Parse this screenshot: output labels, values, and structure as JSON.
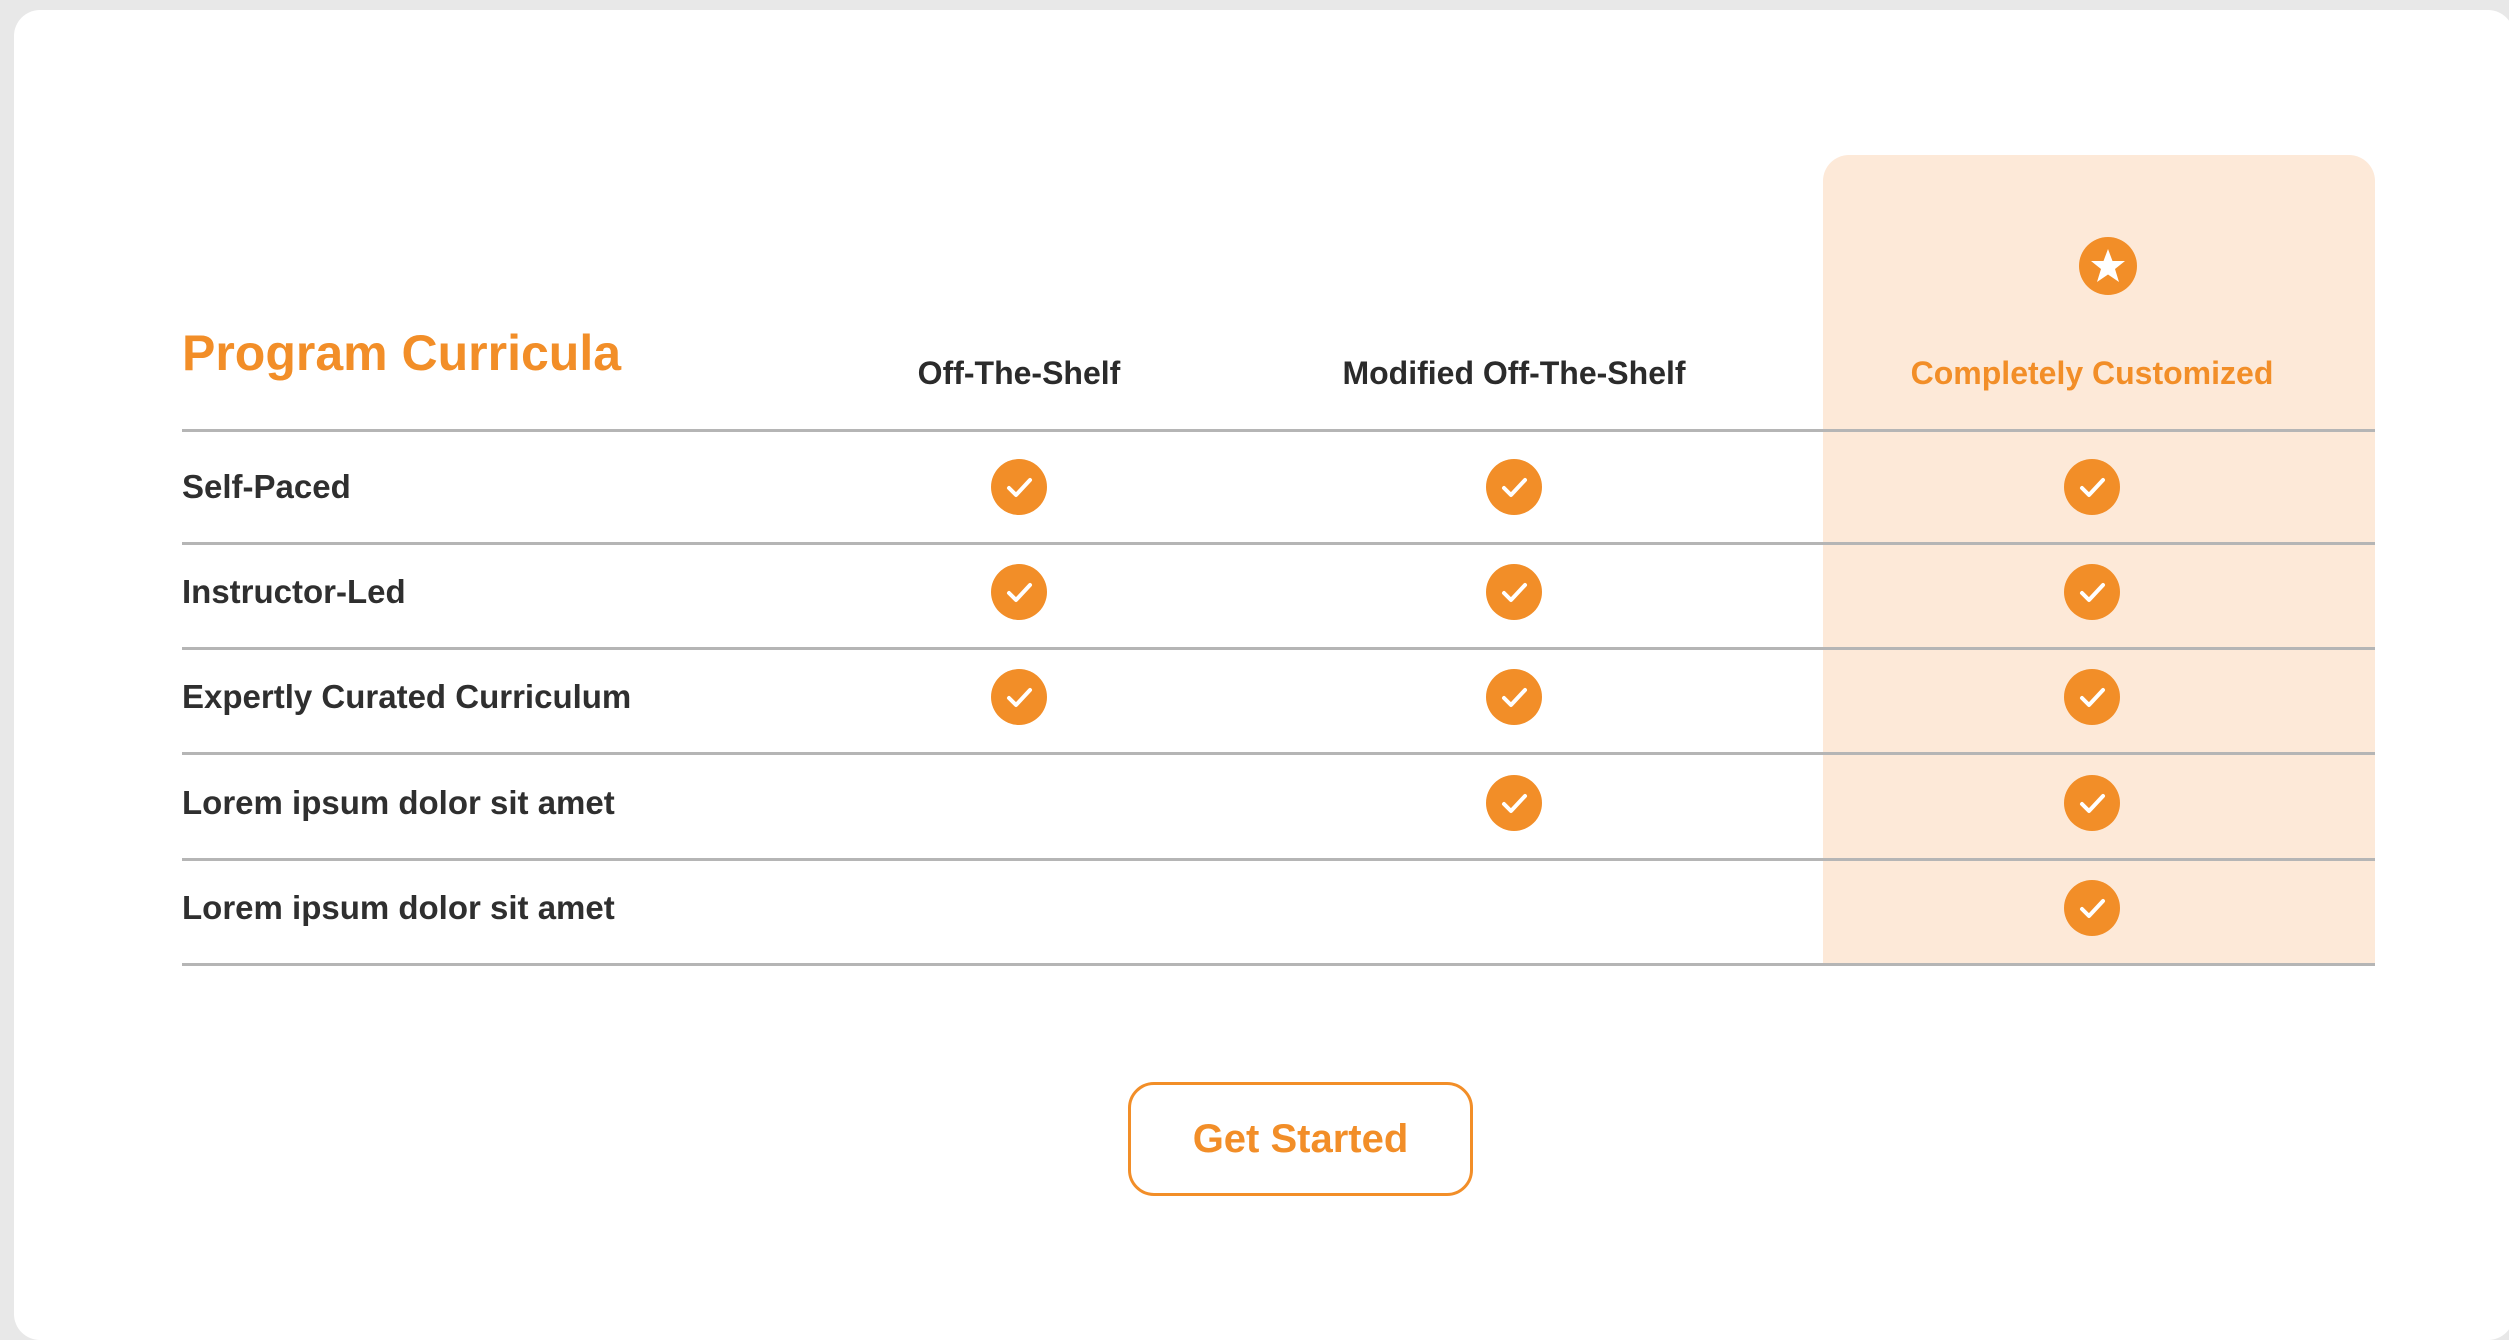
{
  "table": {
    "title": "Program Curricula",
    "columns": [
      {
        "label": "Off-The-Shelf",
        "highlighted": false
      },
      {
        "label": "Modified Off-The-Shelf",
        "highlighted": false
      },
      {
        "label": "Completely Customized",
        "highlighted": true,
        "icon": "star-icon"
      }
    ],
    "rows": [
      {
        "label": "Self-Paced",
        "included": [
          true,
          true,
          true
        ]
      },
      {
        "label": "Instructor-Led",
        "included": [
          true,
          true,
          true
        ]
      },
      {
        "label": "Expertly Curated Curriculum",
        "included": [
          true,
          true,
          true
        ]
      },
      {
        "label": "Lorem ipsum dolor sit amet",
        "included": [
          false,
          true,
          true
        ]
      },
      {
        "label": "Lorem ipsum dolor sit amet",
        "included": [
          false,
          false,
          true
        ]
      }
    ],
    "check_icon": "check-circle-icon"
  },
  "cta": {
    "label": "Get Started"
  },
  "colors": {
    "accent": "#f28e28",
    "highlight_background": "#fde9d8",
    "rule": "#b5b5b5",
    "text": "#2f2f2f"
  }
}
